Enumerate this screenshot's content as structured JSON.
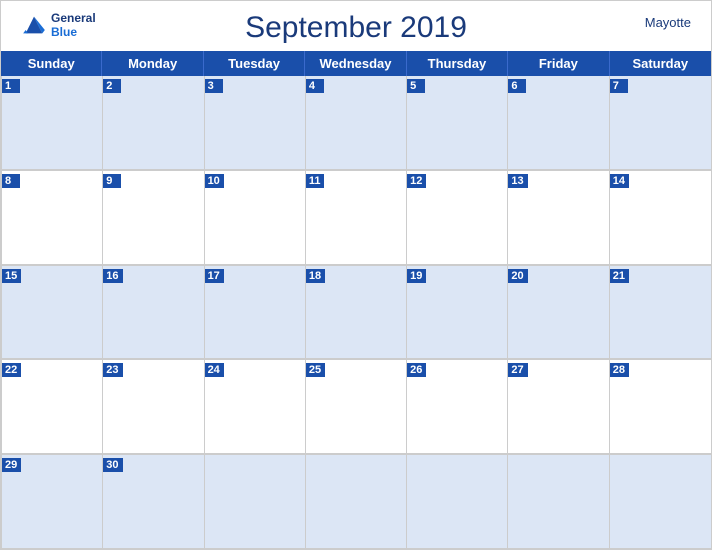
{
  "header": {
    "logo": {
      "general": "General",
      "blue": "Blue"
    },
    "title": "September 2019",
    "region": "Mayotte"
  },
  "dayHeaders": [
    "Sunday",
    "Monday",
    "Tuesday",
    "Wednesday",
    "Thursday",
    "Friday",
    "Saturday"
  ],
  "weeks": [
    {
      "stripe": true,
      "days": [
        {
          "date": "1",
          "empty": false
        },
        {
          "date": "2",
          "empty": false
        },
        {
          "date": "3",
          "empty": false
        },
        {
          "date": "4",
          "empty": false
        },
        {
          "date": "5",
          "empty": false
        },
        {
          "date": "6",
          "empty": false
        },
        {
          "date": "7",
          "empty": false
        }
      ]
    },
    {
      "stripe": false,
      "days": [
        {
          "date": "8",
          "empty": false
        },
        {
          "date": "9",
          "empty": false
        },
        {
          "date": "10",
          "empty": false
        },
        {
          "date": "11",
          "empty": false
        },
        {
          "date": "12",
          "empty": false
        },
        {
          "date": "13",
          "empty": false
        },
        {
          "date": "14",
          "empty": false
        }
      ]
    },
    {
      "stripe": true,
      "days": [
        {
          "date": "15",
          "empty": false
        },
        {
          "date": "16",
          "empty": false
        },
        {
          "date": "17",
          "empty": false
        },
        {
          "date": "18",
          "empty": false
        },
        {
          "date": "19",
          "empty": false
        },
        {
          "date": "20",
          "empty": false
        },
        {
          "date": "21",
          "empty": false
        }
      ]
    },
    {
      "stripe": false,
      "days": [
        {
          "date": "22",
          "empty": false
        },
        {
          "date": "23",
          "empty": false
        },
        {
          "date": "24",
          "empty": false
        },
        {
          "date": "25",
          "empty": false
        },
        {
          "date": "26",
          "empty": false
        },
        {
          "date": "27",
          "empty": false
        },
        {
          "date": "28",
          "empty": false
        }
      ]
    },
    {
      "stripe": true,
      "days": [
        {
          "date": "29",
          "empty": false
        },
        {
          "date": "30",
          "empty": false
        },
        {
          "date": "",
          "empty": true
        },
        {
          "date": "",
          "empty": true
        },
        {
          "date": "",
          "empty": true
        },
        {
          "date": "",
          "empty": true
        },
        {
          "date": "",
          "empty": true
        }
      ]
    }
  ]
}
